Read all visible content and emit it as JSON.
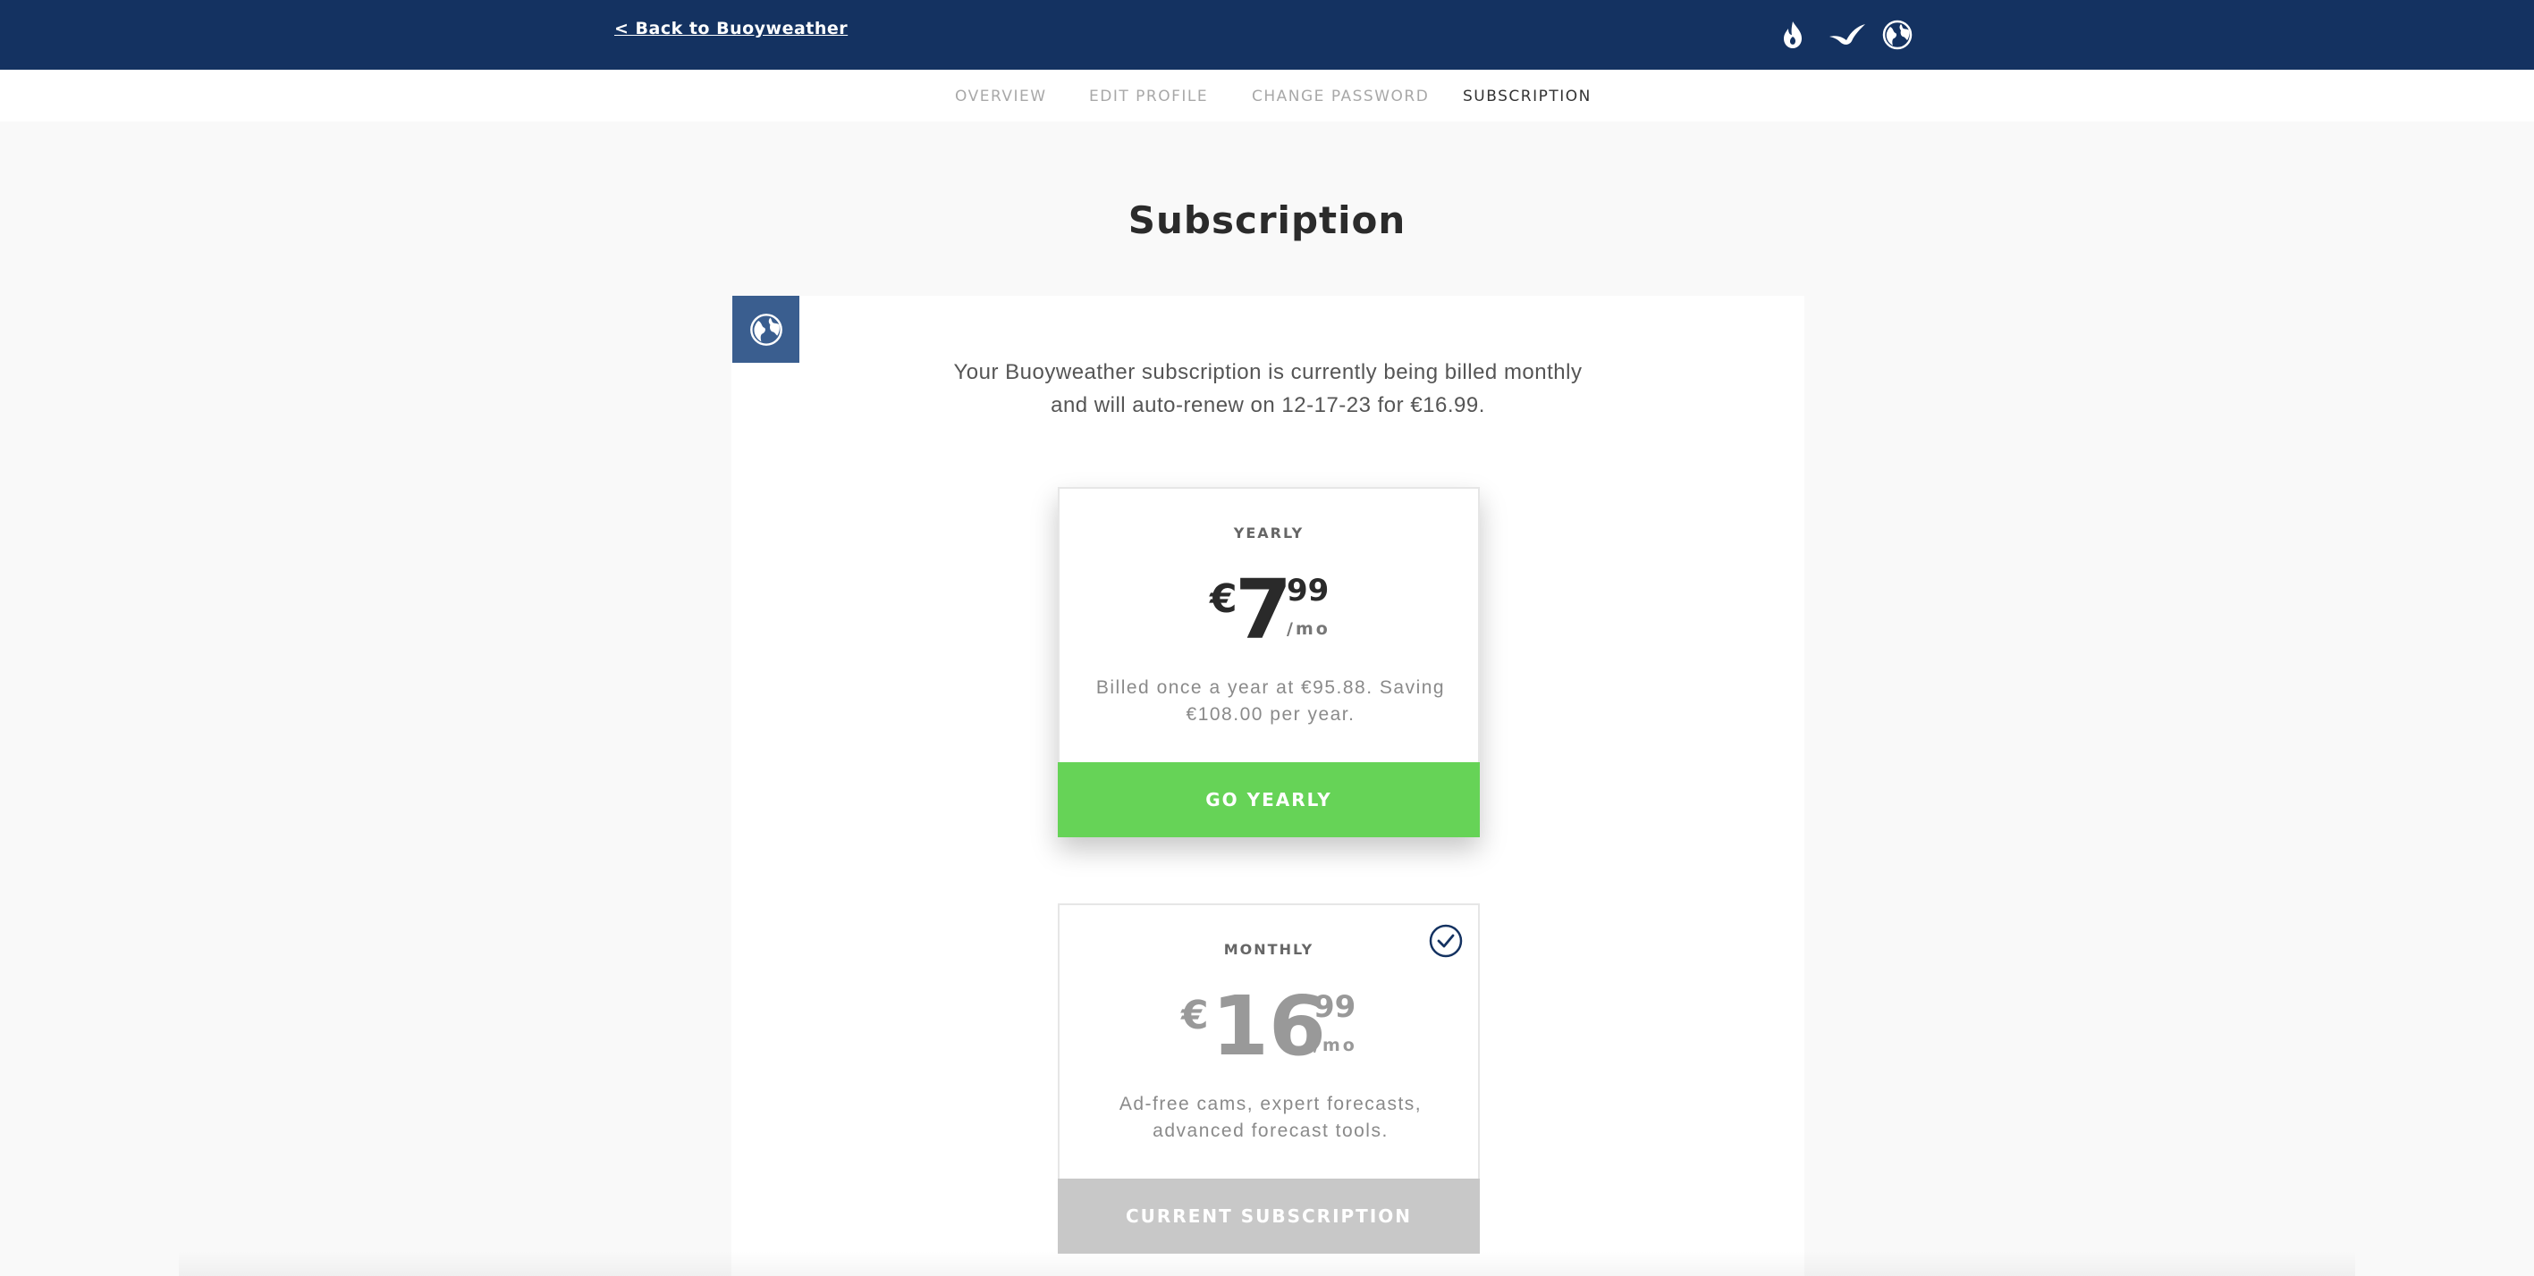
{
  "topbar": {
    "back_label": "< Back to Buoyweather",
    "icons": [
      "flame-icon",
      "bird-icon",
      "globe-icon"
    ]
  },
  "subnav": {
    "items": [
      {
        "label": "OVERVIEW"
      },
      {
        "label": "EDIT PROFILE"
      },
      {
        "label": "CHANGE PASSWORD"
      },
      {
        "label": "SUBSCRIPTION",
        "active": true
      }
    ]
  },
  "page": {
    "title": "Subscription",
    "badge_icon": "globe-icon",
    "billing_text": "Your Buoyweather subscription is currently being billed monthly and will auto-renew on 12-17-23 for €16.99."
  },
  "plans": {
    "yearly": {
      "label": "YEARLY",
      "currency": "€",
      "price_int": "7",
      "price_cents": "99",
      "per": "/mo",
      "description": "Billed once a year at €95.88. Saving €108.00 per year.",
      "button": "GO YEARLY"
    },
    "monthly": {
      "label": "MONTHLY",
      "currency": "€",
      "price_int": "16",
      "price_cents": "99",
      "per": "/mo",
      "description": "Ad-free cams, expert forecasts, advanced forecast tools.",
      "button": "CURRENT SUBSCRIPTION",
      "selected": true
    }
  },
  "colors": {
    "topbar": "#143261",
    "badge": "#3a5e8f",
    "go_button": "#66d357",
    "current_button": "#c8c8c8"
  }
}
